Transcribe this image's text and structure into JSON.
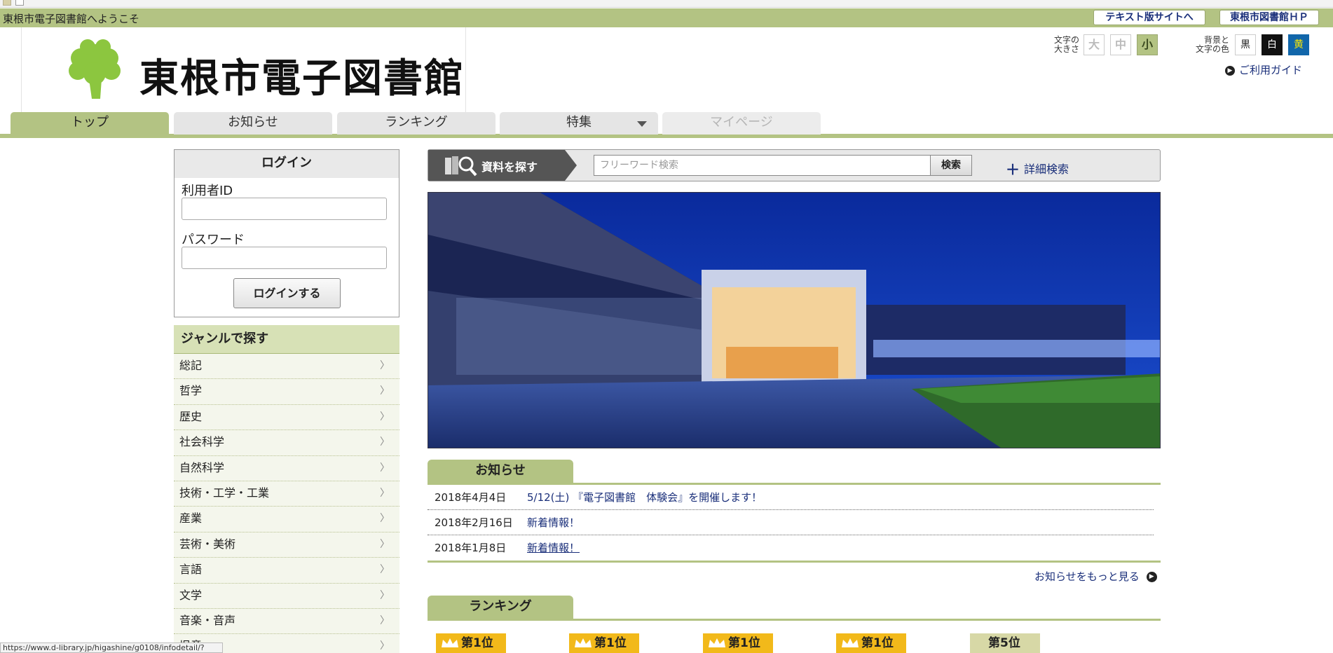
{
  "top_bar": {
    "welcome": "東根市電子図書館へようこそ",
    "text_site_link": "テキスト版サイトへ",
    "library_hp_link": "東根市図書館ＨＰ"
  },
  "header": {
    "logo_title": "東根市電子図書館",
    "font_size_label_1": "文字の",
    "font_size_label_2": "大きさ",
    "font_sizes": [
      "大",
      "中",
      "小"
    ],
    "color_label_1": "背景と",
    "color_label_2": "文字の色",
    "colors": [
      "黒",
      "白",
      "黄"
    ],
    "guide_link": "ご利用ガイド"
  },
  "nav": {
    "tabs": [
      "トップ",
      "お知らせ",
      "ランキング",
      "特集",
      "マイページ"
    ]
  },
  "login": {
    "heading": "ログイン",
    "user_id_label": "利用者ID",
    "password_label": "パスワード",
    "submit": "ログインする"
  },
  "genre": {
    "heading": "ジャンルで探す",
    "items": [
      "総記",
      "哲学",
      "歴史",
      "社会科学",
      "自然科学",
      "技術・工学・工業",
      "産業",
      "芸術・美術",
      "言語",
      "文学",
      "音楽・音声",
      "児童"
    ]
  },
  "search": {
    "label": "資料を探す",
    "placeholder": "フリーワード検索",
    "button": "検索",
    "advanced": "詳細検索"
  },
  "notices": {
    "heading": "お知らせ",
    "rows": [
      {
        "date": "2018年4月4日",
        "title": "5/12(土) 『電子図書館　体験会』を開催します！"
      },
      {
        "date": "2018年2月16日",
        "title": "新着情報！"
      },
      {
        "date": "2018年1月8日",
        "title": "新着情報！"
      }
    ],
    "more": "お知らせをもっと見る"
  },
  "ranking": {
    "heading": "ランキング",
    "badges": [
      "第1位",
      "第1位",
      "第1位",
      "第1位",
      "第5位"
    ]
  },
  "status_url": "https://www.d-library.jp/higashine/g0108/infodetail/?iid=9",
  "colors": {
    "accent_green": "#b3c383",
    "link_blue": "#1a2f7a",
    "rank_gold": "#f2b91a"
  }
}
